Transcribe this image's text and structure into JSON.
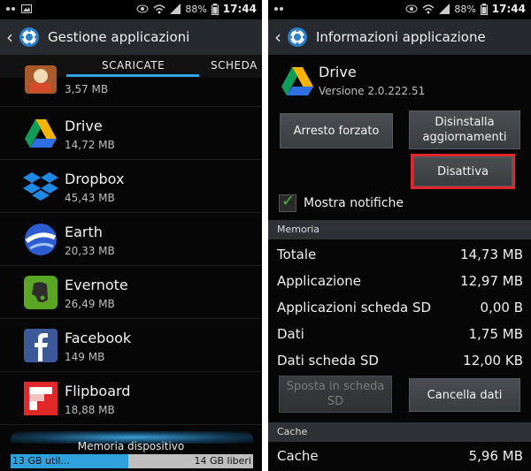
{
  "statusbar": {
    "left": {
      "battery_pct": "88%",
      "time": "17:44"
    },
    "right": {
      "battery_pct": "88%",
      "time": "17:44"
    }
  },
  "left": {
    "title": "Gestione applicazioni",
    "tabs": {
      "active": "SCARICATE",
      "next": "SCHEDA"
    },
    "apps": [
      {
        "name": "",
        "size": "3,57 MB",
        "icon": "app-icon-partial"
      },
      {
        "name": "Drive",
        "size": "14,72 MB",
        "icon": "drive-icon"
      },
      {
        "name": "Dropbox",
        "size": "45,43 MB",
        "icon": "dropbox-icon"
      },
      {
        "name": "Earth",
        "size": "20,33 MB",
        "icon": "earth-icon"
      },
      {
        "name": "Evernote",
        "size": "26,49 MB",
        "icon": "evernote-icon"
      },
      {
        "name": "Facebook",
        "size": "149 MB",
        "icon": "facebook-icon"
      },
      {
        "name": "Flipboard",
        "size": "18,88 MB",
        "icon": "flipboard-icon"
      }
    ],
    "storage": {
      "label": "Memoria dispositivo",
      "used": "13 GB util...",
      "free": "14 GB liberi",
      "used_fraction": 0.485
    }
  },
  "right": {
    "title": "Informazioni applicazione",
    "app": {
      "name": "Drive",
      "version": "Versione 2.0.222.51"
    },
    "buttons": {
      "force_stop": "Arresto forzato",
      "uninstall_updates": "Disinstalla aggiornamenti",
      "disable": "Disattiva",
      "move_sd": "Sposta in scheda SD",
      "clear_data": "Cancella dati"
    },
    "notifications": {
      "label": "Mostra notifiche",
      "checked": true
    },
    "memory": {
      "header": "Memoria",
      "rows": [
        {
          "label": "Totale",
          "value": "14,73 MB"
        },
        {
          "label": "Applicazione",
          "value": "12,97 MB"
        },
        {
          "label": "Applicazioni scheda SD",
          "value": "0,00 B"
        },
        {
          "label": "Dati",
          "value": "1,75 MB"
        },
        {
          "label": "Dati scheda SD",
          "value": "12,00 KB"
        }
      ]
    },
    "cache": {
      "header": "Cache",
      "rows": [
        {
          "label": "Cache",
          "value": "5,96 MB"
        }
      ]
    }
  },
  "colors": {
    "accent": "#32a4e3",
    "highlight": "#e0262a",
    "check": "#4fb33a"
  }
}
